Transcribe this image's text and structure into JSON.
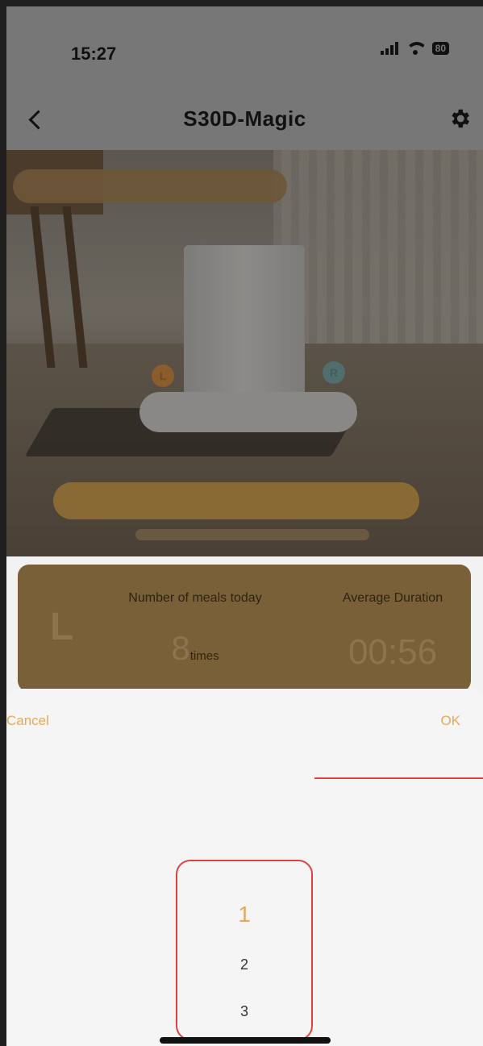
{
  "status_bar": {
    "time": "15:27",
    "battery": "80"
  },
  "header": {
    "title": "S30D-Magic"
  },
  "hero": {
    "left_bowl_badge": "L",
    "right_bowl_badge": "R"
  },
  "stats": {
    "bowl_letter": "L",
    "meals_label": "Number of meals today",
    "meals_value": "8",
    "meals_unit": "times",
    "duration_label": "Average Duration",
    "duration_value": "00:56"
  },
  "sheet": {
    "cancel_label": "Cancel",
    "ok_label": "OK",
    "options": [
      "1",
      "2",
      "3"
    ],
    "selected": "1"
  },
  "colors": {
    "accent": "#e6a95a",
    "highlight": "#e04040"
  }
}
